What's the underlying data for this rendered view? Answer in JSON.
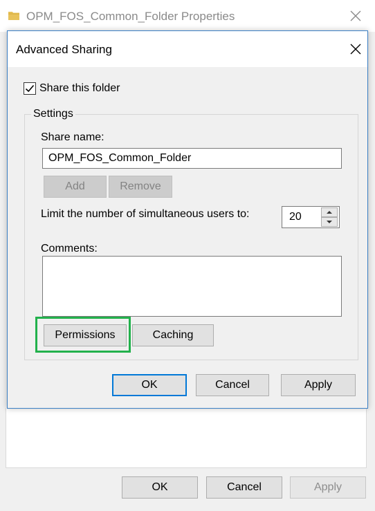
{
  "properties_window": {
    "title": "OPM_FOS_Common_Folder Properties",
    "ok_label": "OK",
    "cancel_label": "Cancel",
    "apply_label": "Apply"
  },
  "dialog": {
    "title": "Advanced Sharing",
    "share_checkbox": {
      "label": "Share this folder",
      "checked": true
    },
    "settings_group": "Settings",
    "share_name_label": "Share name:",
    "share_name_value": "OPM_FOS_Common_Folder",
    "add_label": "Add",
    "remove_label": "Remove",
    "limit_label": "Limit the number of simultaneous users to:",
    "limit_value": "20",
    "comments_label": "Comments:",
    "comments_value": "",
    "permissions_label": "Permissions",
    "caching_label": "Caching",
    "ok_label": "OK",
    "cancel_label": "Cancel",
    "apply_label": "Apply"
  },
  "colors": {
    "highlight": "#22b14c",
    "dialog_border": "#3b7fc4",
    "default_button_border": "#0078d7",
    "folder_icon": "#e8c25a"
  },
  "icons": [
    "folder-icon",
    "close-icon",
    "checkmark-icon",
    "spin-up-icon",
    "spin-down-icon"
  ]
}
